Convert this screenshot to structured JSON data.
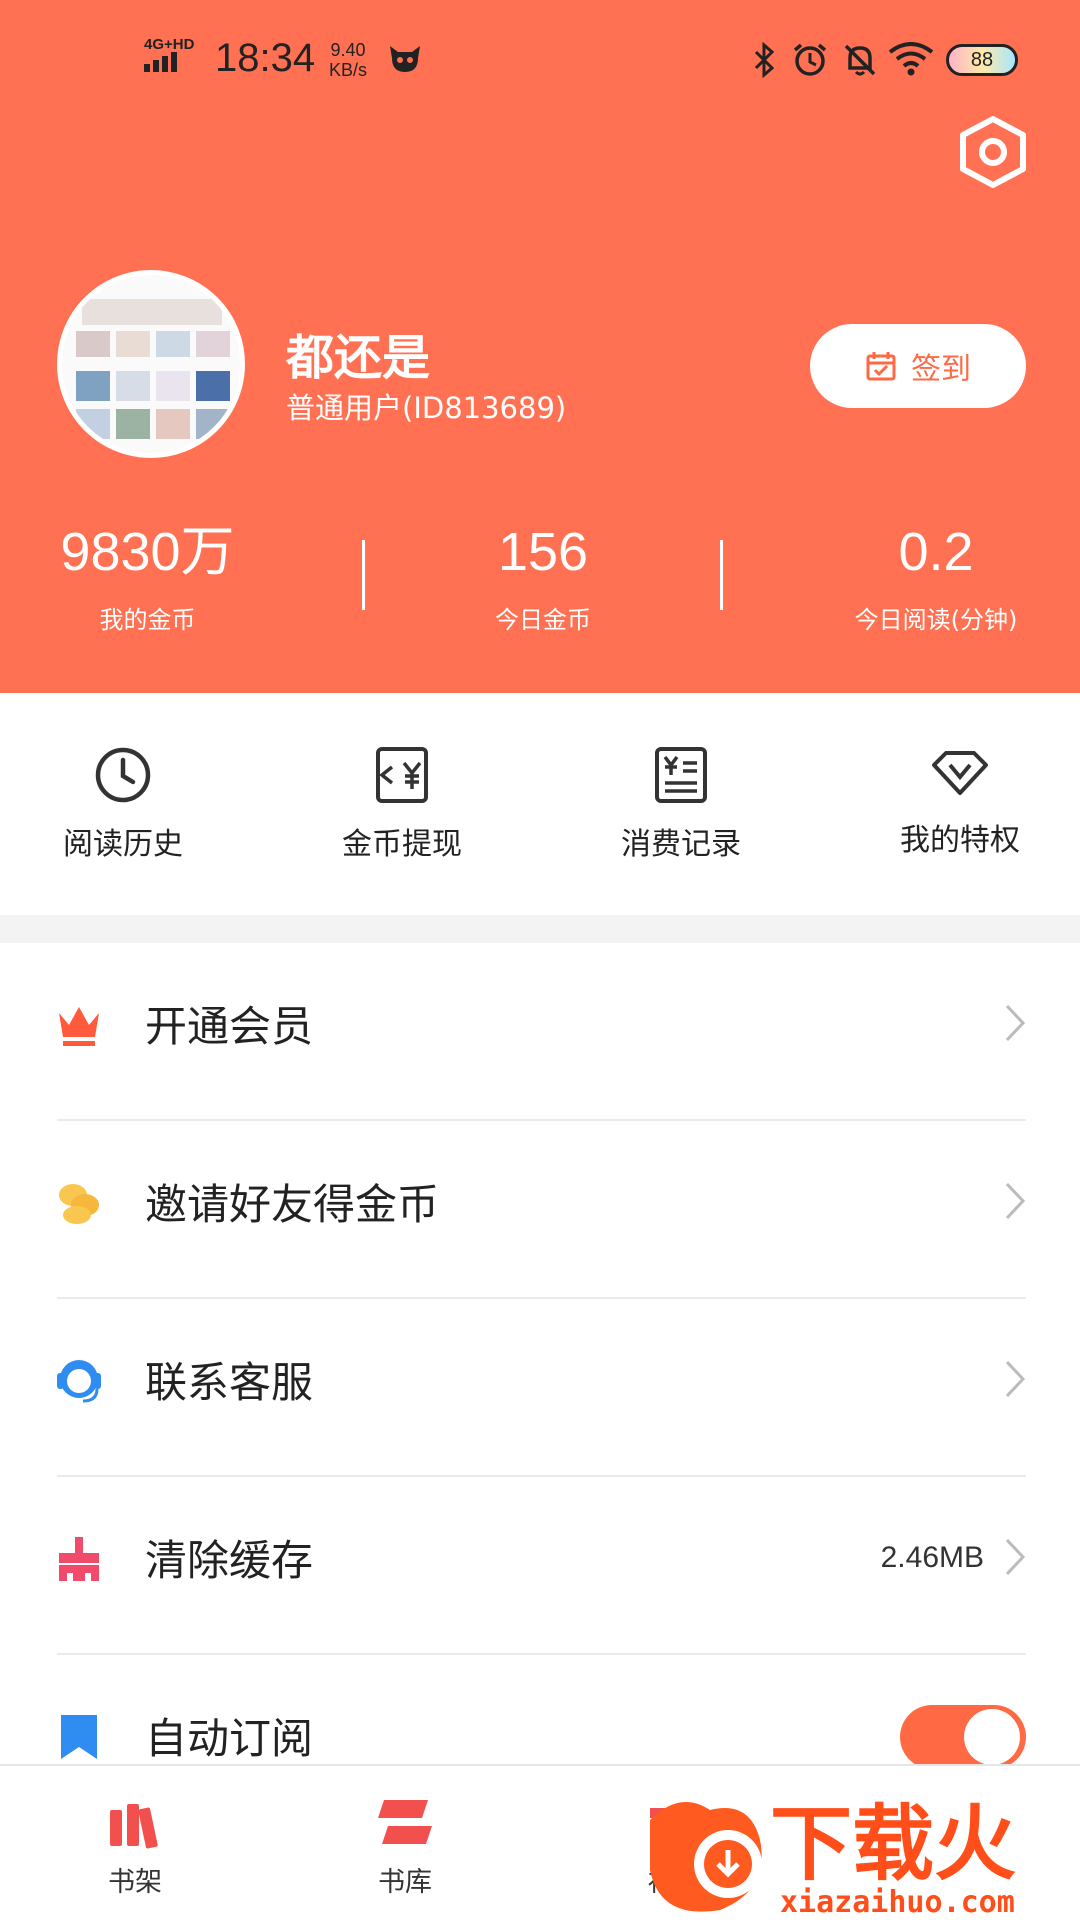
{
  "status_bar": {
    "network": "4G+HD",
    "time": "18:34",
    "speed_value": "9.40",
    "speed_unit": "KB/s",
    "battery": "88"
  },
  "profile": {
    "username": "都还是",
    "user_id": "普通用户(ID813689)",
    "checkin_label": "签到"
  },
  "stats": [
    {
      "value": "9830万",
      "label": "我的金币"
    },
    {
      "value": "156",
      "label": "今日金币"
    },
    {
      "value": "0.2",
      "label": "今日阅读(分钟)"
    }
  ],
  "quick_actions": [
    {
      "label": "阅读历史",
      "icon": "clock-icon"
    },
    {
      "label": "金币提现",
      "icon": "coin-withdraw-icon"
    },
    {
      "label": "消费记录",
      "icon": "bill-icon"
    },
    {
      "label": "我的特权",
      "icon": "diamond-icon"
    }
  ],
  "menu": [
    {
      "label": "开通会员",
      "icon": "crown-icon",
      "color": "#FF5A3C"
    },
    {
      "label": "邀请好友得金币",
      "icon": "coins-icon",
      "color": "#F6B73C"
    },
    {
      "label": "联系客服",
      "icon": "headset-icon",
      "color": "#2F8CF0"
    },
    {
      "label": "清除缓存",
      "icon": "broom-icon",
      "color": "#F24A6A",
      "extra": "2.46MB"
    },
    {
      "label": "自动订阅",
      "icon": "bookmark-icon",
      "color": "#2F8CF0",
      "toggle": true
    }
  ],
  "tabs": [
    {
      "label": "书架",
      "icon": "books-icon"
    },
    {
      "label": "书库",
      "icon": "library-icon"
    },
    {
      "label": "福利",
      "icon": "gift-icon"
    }
  ],
  "watermark": {
    "brand": "下载火",
    "url": "xiazaihuo.com"
  },
  "colors": {
    "header": "#FF7152",
    "accent": "#FF6A44"
  }
}
